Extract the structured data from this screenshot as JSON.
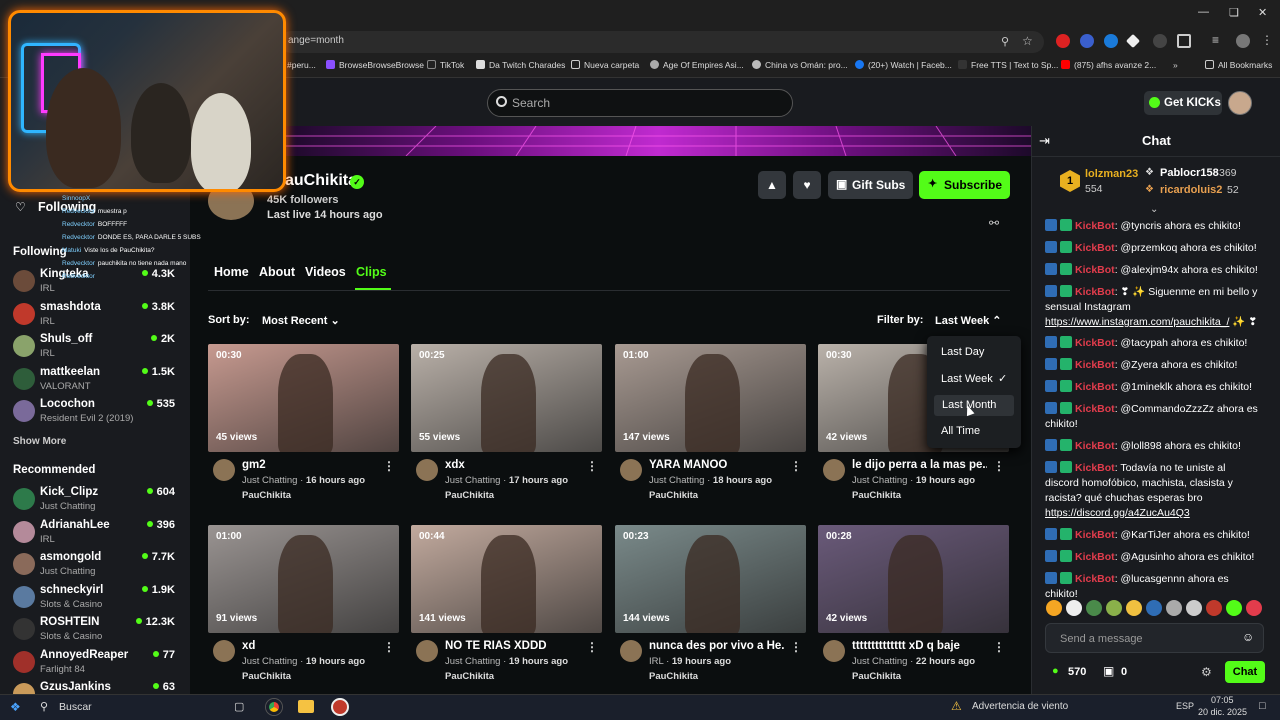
{
  "browser": {
    "url_fragment": "ange=month",
    "bookmarks": [
      {
        "label": "#peru..."
      },
      {
        "label": "BrowseBrowseBrowse"
      },
      {
        "label": "TikTok"
      },
      {
        "label": "Da Twitch Charades"
      },
      {
        "label": "Nueva carpeta"
      },
      {
        "label": "Age Of Empires Asi..."
      },
      {
        "label": "China vs Omán: pro..."
      },
      {
        "label": "(20+) Watch | Faceb..."
      },
      {
        "label": "Free TTS | Text to Sp..."
      },
      {
        "label": "(875) afhs avanze 2..."
      },
      {
        "label": "All Bookmarks"
      }
    ]
  },
  "header": {
    "search_placeholder": "Search",
    "get_kicks": "Get KICKs"
  },
  "sidebar": {
    "following_title": "Following",
    "following_section": "Following",
    "following": [
      {
        "name": "Kingteka",
        "category": "IRL",
        "viewers": "4.3K",
        "color": "#6b4b3a"
      },
      {
        "name": "smashdota",
        "category": "IRL",
        "viewers": "3.8K",
        "color": "#c0392b"
      },
      {
        "name": "Shuls_off",
        "category": "IRL",
        "viewers": "2K",
        "color": "#8aa36b"
      },
      {
        "name": "mattkeelan",
        "category": "VALORANT",
        "viewers": "1.5K",
        "color": "#2e5d3a"
      },
      {
        "name": "Locochon",
        "category": "Resident Evil 2 (2019)",
        "viewers": "535",
        "color": "#7a6a9a"
      }
    ],
    "show_more": "Show More",
    "recommended_title": "Recommended",
    "recommended": [
      {
        "name": "Kick_Clipz",
        "category": "Just Chatting",
        "viewers": "604",
        "color": "#2d7a4a"
      },
      {
        "name": "AdrianahLee",
        "category": "IRL",
        "viewers": "396",
        "color": "#b48a9a"
      },
      {
        "name": "asmongold",
        "category": "Just Chatting",
        "viewers": "7.7K",
        "color": "#8a6a5a"
      },
      {
        "name": "schneckyirl",
        "category": "Slots & Casino",
        "viewers": "1.9K",
        "color": "#5a7aa0"
      },
      {
        "name": "ROSHTEIN",
        "category": "Slots & Casino",
        "viewers": "12.3K",
        "color": "#333"
      },
      {
        "name": "AnnoyedReaper",
        "category": "Farlight 84",
        "viewers": "77",
        "color": "#a0302a"
      },
      {
        "name": "GzusJankins",
        "category": "",
        "viewers": "63",
        "color": "#c99a5a"
      }
    ]
  },
  "overlay_chat": [
    {
      "user": "SinnoopX",
      "text": ""
    },
    {
      "user": "Redvecktor",
      "text": "muestra p"
    },
    {
      "user": "Redvecktor",
      "text": "BOFFFFF"
    },
    {
      "user": "Redvecktor",
      "text": "DONDE ES, PARA DARLE 5 SUBS"
    },
    {
      "user": "Matuki",
      "text": "Viste los de PauChikita?"
    },
    {
      "user": "Redvecktor",
      "text": "pauchikita no tiene nada mano"
    },
    {
      "user": "Redvecktor",
      "text": ""
    }
  ],
  "channel": {
    "name": "PauChikita",
    "name_visible": "auChikita",
    "followers": "45K followers",
    "last_live": "Last live 14 hours ago",
    "gift_subs": "Gift Subs",
    "subscribe": "Subscribe"
  },
  "tabs": [
    "Home",
    "About",
    "Videos",
    "Clips"
  ],
  "sort": {
    "label": "Sort by:",
    "value": "Most Recent"
  },
  "filter": {
    "label": "Filter by:",
    "value": "Last Week",
    "options": [
      "Last Day",
      "Last Week",
      "Last Month",
      "All Time"
    ],
    "selected": "Last Week",
    "hovered": "Last Month"
  },
  "clips": [
    {
      "duration": "00:30",
      "views": "45 views",
      "title": "gm2",
      "category": "Just Chatting",
      "age": "16 hours ago",
      "author": "PauChikita",
      "tone": "#c79a90"
    },
    {
      "duration": "00:25",
      "views": "55 views",
      "title": "xdx",
      "category": "Just Chatting",
      "age": "17 hours ago",
      "author": "PauChikita",
      "tone": "#b9b0a8"
    },
    {
      "duration": "01:00",
      "views": "147 views",
      "title": "YARA MANOO",
      "category": "Just Chatting",
      "age": "18 hours ago",
      "author": "PauChikita",
      "tone": "#a89a92"
    },
    {
      "duration": "00:30",
      "views": "42 views",
      "title": "le dijo perra a la mas pe...",
      "category": "Just Chatting",
      "age": "19 hours ago",
      "author": "PauChikita",
      "tone": "#bab2aa"
    },
    {
      "duration": "01:00",
      "views": "91 views",
      "title": "xd",
      "category": "Just Chatting",
      "age": "19 hours ago",
      "author": "PauChikita",
      "tone": "#9a9492"
    },
    {
      "duration": "00:44",
      "views": "141 views",
      "title": "NO TE RIAS XDDD",
      "category": "Just Chatting",
      "age": "19 hours ago",
      "author": "PauChikita",
      "tone": "#c2aa9e"
    },
    {
      "duration": "00:23",
      "views": "144 views",
      "title": "nunca des por vivo a He...",
      "category": "IRL",
      "age": "19 hours ago",
      "author": "PauChikita",
      "tone": "#7a8a8a"
    },
    {
      "duration": "00:28",
      "views": "42 views",
      "title": "tttttttttttttt xD q baje",
      "category": "Just Chatting",
      "age": "22 hours ago",
      "author": "PauChikita",
      "tone": "#6a5a7a"
    }
  ],
  "chat": {
    "title": "Chat",
    "leaders": [
      {
        "rank": "1",
        "name": "lolzman23",
        "count": "554"
      },
      {
        "name": "Pablocr158",
        "count": "369"
      },
      {
        "name": "ricardoluis2",
        "count": "52"
      }
    ],
    "messages": [
      {
        "user": "KickBot",
        "text": ": @tyncris ahora es chikito!"
      },
      {
        "user": "KickBot",
        "text": ": @przemkoq ahora es chikito!"
      },
      {
        "user": "KickBot",
        "text": ": @alexjm94x ahora es chikito!"
      },
      {
        "user": "KickBot",
        "text": ": ❣ ✨ Siguenme en mi bello y sensual Instagram ",
        "link": "https://www.instagram.com/pauchikita_/",
        "tail": " ✨ ❣"
      },
      {
        "user": "KickBot",
        "text": ": @tacypah ahora es chikito!"
      },
      {
        "user": "KickBot",
        "text": ": @Zyera ahora es chikito!"
      },
      {
        "user": "KickBot",
        "text": ": @1mineklk ahora es chikito!"
      },
      {
        "user": "KickBot",
        "text": ": @CommandoZzzZz ahora es chikito!"
      },
      {
        "user": "KickBot",
        "text": ": @loll898 ahora es chikito!"
      },
      {
        "user": "KickBot",
        "text": ": Todavía no te uniste al discord homofóbico, machista, clasista y racista? qué chuchas esperas bro ",
        "link": "https://discord.gg/a4ZucAu4Q3"
      },
      {
        "user": "KickBot",
        "text": ": @KarTiJer ahora es chikito!"
      },
      {
        "user": "KickBot",
        "text": ": @Agusinho ahora es chikito!"
      },
      {
        "user": "KickBot",
        "text": ": @lucasgennn ahora es chikito!"
      }
    ],
    "send_placeholder": "Send a message",
    "kicks": "570",
    "points": "0",
    "chat_button": "Chat"
  },
  "taskbar": {
    "search": "Buscar",
    "weather": "Advertencia de viento",
    "lang": "ESP",
    "time": "07:05",
    "date": "20 dic. 2025"
  },
  "colors": {
    "brand": "#53fc18",
    "kickbot": "#e23c4c",
    "webcam_border": "#ff8a00"
  }
}
